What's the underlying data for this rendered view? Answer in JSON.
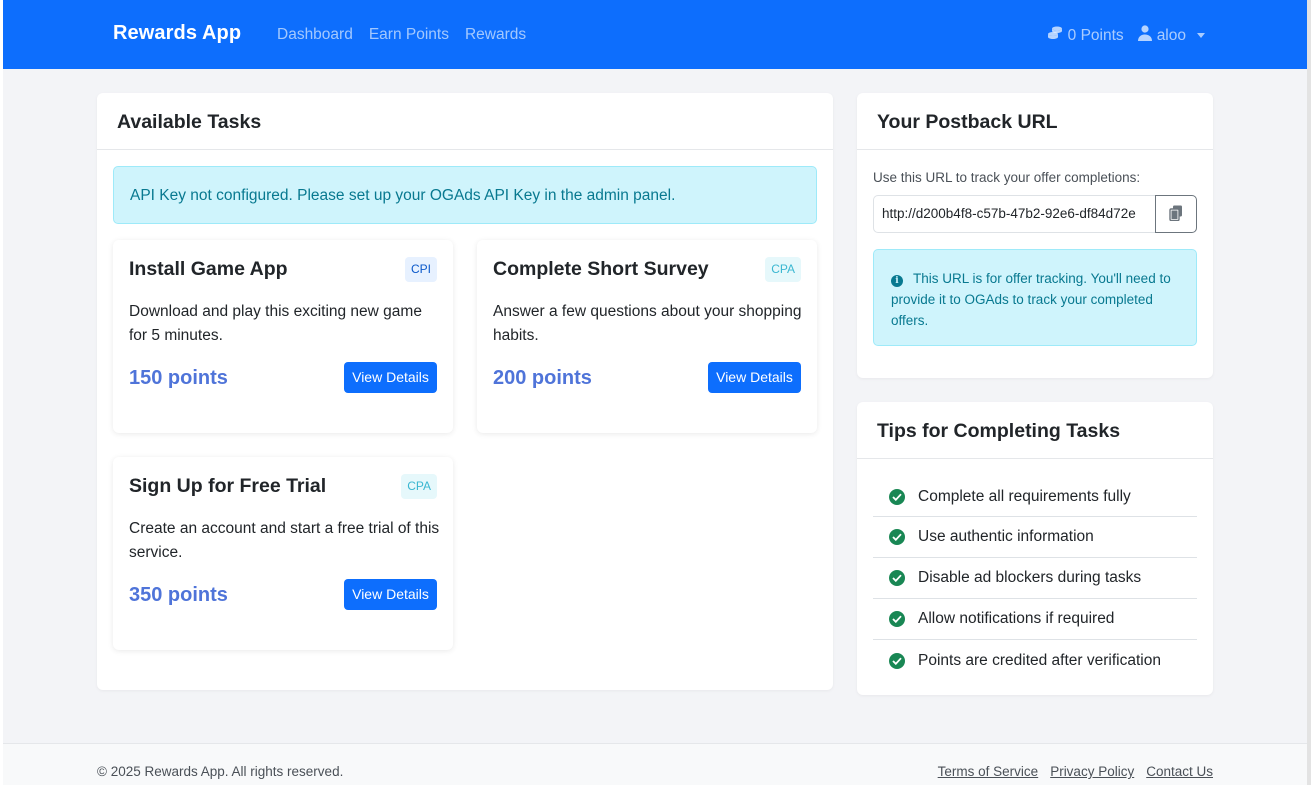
{
  "navbar": {
    "brand": "Rewards App",
    "links": [
      "Dashboard",
      "Earn Points",
      "Rewards"
    ],
    "points": "0 Points",
    "user": "aloo"
  },
  "tasks_card": {
    "title": "Available Tasks",
    "alert": "API Key not configured. Please set up your OGAds API Key in the admin panel.",
    "tasks": [
      {
        "title": "Install Game App",
        "badge": "CPI",
        "description": "Download and play this exciting new game for 5 minutes.",
        "points": "150 points",
        "button": "View Details"
      },
      {
        "title": "Complete Short Survey",
        "badge": "CPA",
        "description": "Answer a few questions about your shopping habits.",
        "points": "200 points",
        "button": "View Details"
      },
      {
        "title": "Sign Up for Free Trial",
        "badge": "CPA",
        "description": "Create an account and start a free trial of this service.",
        "points": "350 points",
        "button": "View Details"
      }
    ]
  },
  "postback_card": {
    "title": "Your Postback URL",
    "label": "Use this URL to track your offer completions:",
    "url": "http://d200b4f8-c57b-47b2-92e6-df84d72e",
    "info": "This URL is for offer tracking. You'll need to provide it to OGAds to track your completed offers."
  },
  "tips_card": {
    "title": "Tips for Completing Tasks",
    "tips": [
      "Complete all requirements fully",
      "Use authentic information",
      "Disable ad blockers during tasks",
      "Allow notifications if required",
      "Points are credited after verification"
    ]
  },
  "footer": {
    "copyright": "© 2025 Rewards App. All rights reserved.",
    "links": [
      "Terms of Service",
      "Privacy Policy",
      "Contact Us"
    ]
  },
  "colors": {
    "primary": "#0d6efd",
    "info_bg": "#cff4fc",
    "info_text": "#087990",
    "success": "#198754",
    "points": "#4f74d9"
  },
  "icons": {
    "points": "coins-icon",
    "user": "user-icon",
    "copy": "copy-icon",
    "info": "info-circle-icon",
    "tip": "check-circle-icon"
  }
}
